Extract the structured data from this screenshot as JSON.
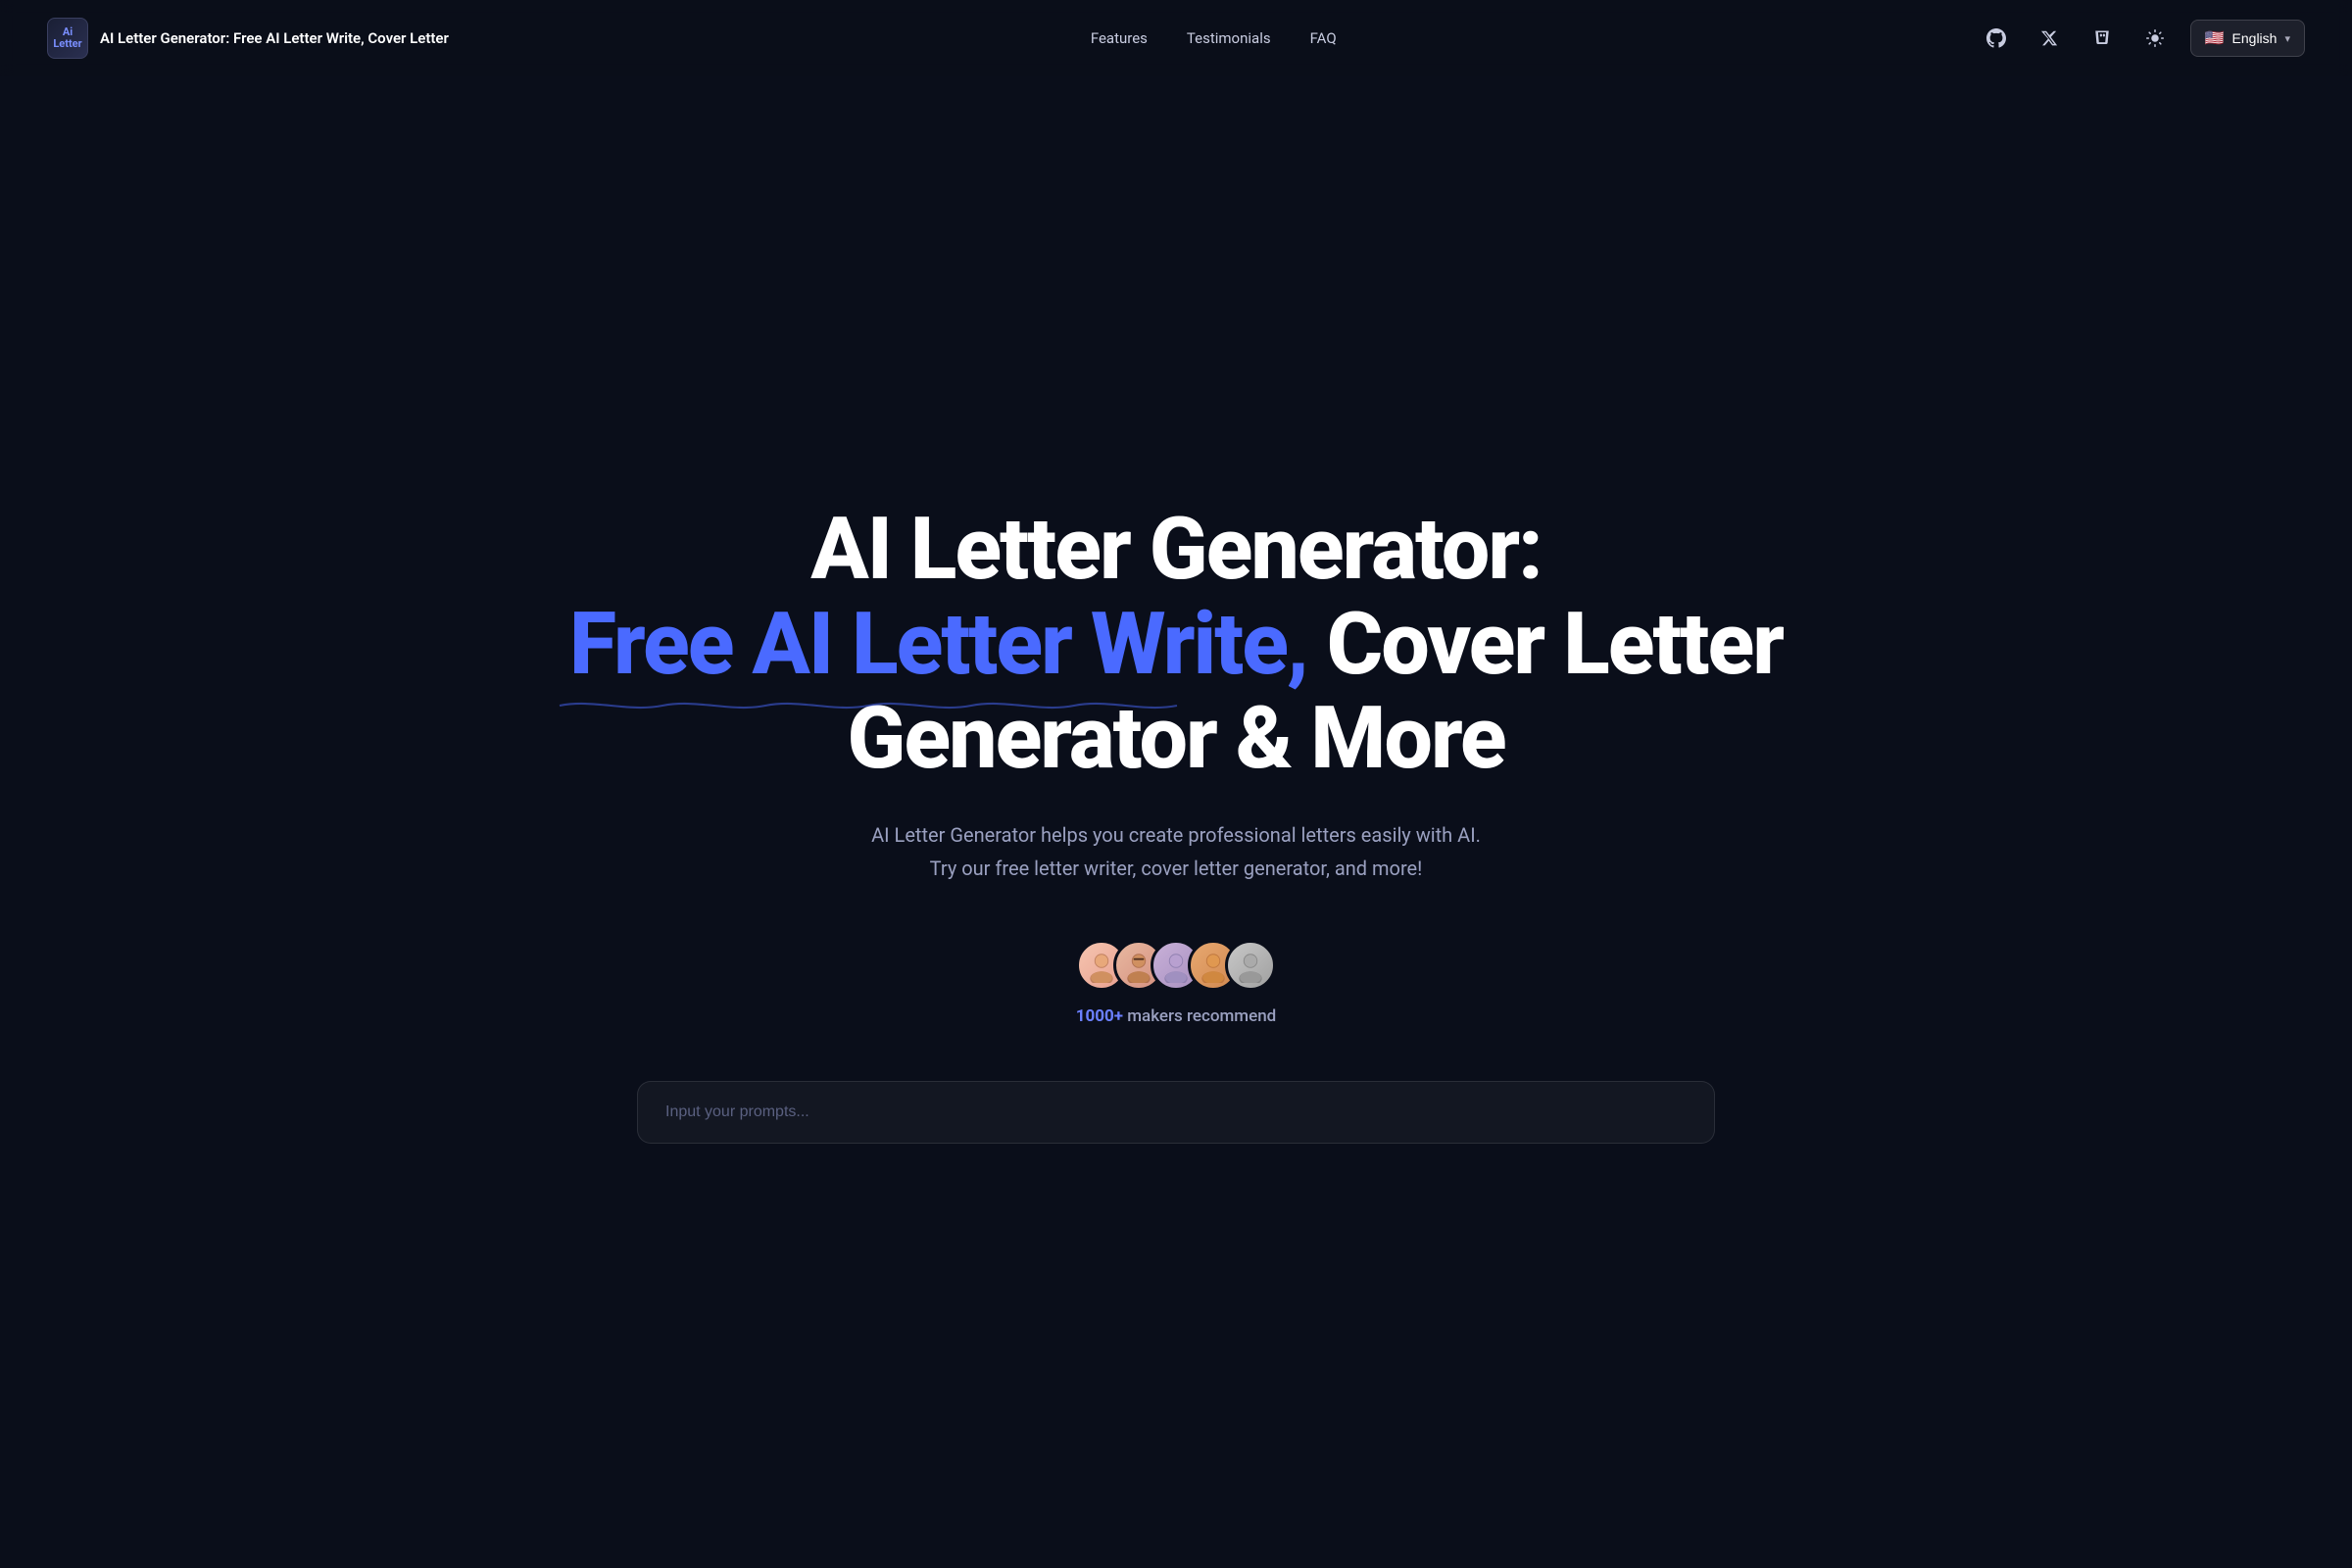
{
  "navbar": {
    "logo_text": "Ai\nLetter",
    "site_title": "AI Letter Generator: Free AI Letter Write, Cover Letter",
    "nav_items": [
      {
        "label": "Features",
        "id": "features"
      },
      {
        "label": "Testimonials",
        "id": "testimonials"
      },
      {
        "label": "FAQ",
        "id": "faq"
      }
    ],
    "icons": [
      {
        "name": "github-icon",
        "symbol": "⊙"
      },
      {
        "name": "x-twitter-icon",
        "symbol": "𝕏"
      },
      {
        "name": "coffee-icon",
        "symbol": "🗑"
      },
      {
        "name": "theme-toggle-icon",
        "symbol": "☀"
      }
    ],
    "language": {
      "flag": "🇺🇸",
      "label": "English"
    }
  },
  "hero": {
    "title_line1": "AI Letter Generator:",
    "title_line2_highlight": "Free AI Letter Write,",
    "title_line2_rest": " Cover Letter",
    "title_line3": "Generator & More",
    "subtitle_line1": "AI Letter Generator helps you create professional letters easily with AI.",
    "subtitle_line2": "Try our free letter writer, cover letter generator, and more!",
    "makers_count": "1000+",
    "makers_text": "makers recommend",
    "input_placeholder": "Input your prompts..."
  },
  "avatars": [
    {
      "emoji": "😊",
      "bg": "avatar-1"
    },
    {
      "emoji": "😎",
      "bg": "avatar-2"
    },
    {
      "emoji": "🙂",
      "bg": "avatar-3"
    },
    {
      "emoji": "😄",
      "bg": "avatar-4"
    },
    {
      "emoji": "🧑",
      "bg": "avatar-5"
    }
  ]
}
